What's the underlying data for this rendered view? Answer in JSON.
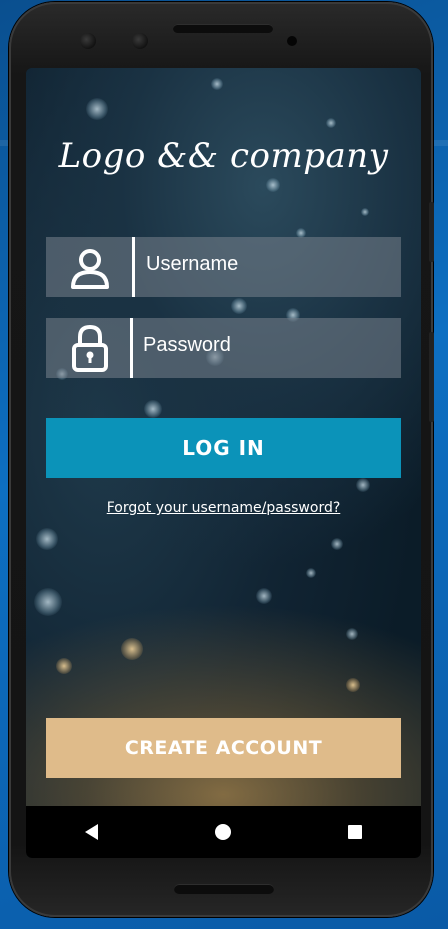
{
  "logo": {
    "text": "Logo && company"
  },
  "form": {
    "username_label": "Username",
    "password_label": "Password",
    "login_label": "LOG IN",
    "forgot_label": "Forgot your username/password?",
    "create_account_label": "CREATE ACCOUNT"
  },
  "icons": {
    "user": "user-icon",
    "lock": "lock-icon",
    "back": "back-icon",
    "home": "home-icon",
    "recents": "recents-icon"
  },
  "colors": {
    "login_button": "#0b93b9",
    "create_button": "#dfbb8a",
    "field_background": "rgba(120,130,140,0.55)"
  }
}
